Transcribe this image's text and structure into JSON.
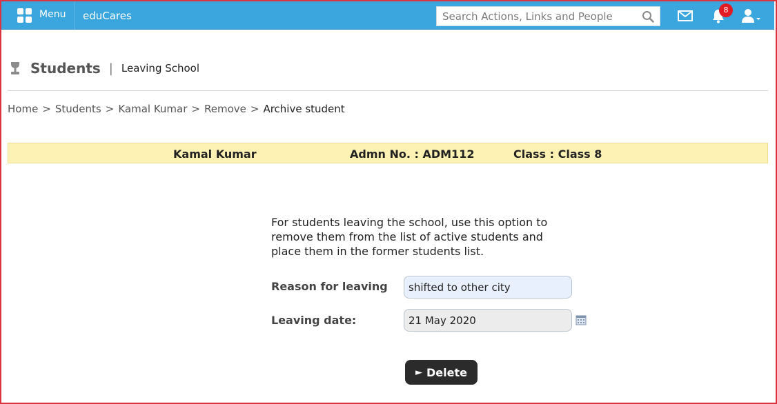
{
  "header": {
    "menu_label": "Menu",
    "brand": "eduCares",
    "search_placeholder": "Search Actions, Links and People",
    "notification_count": "8",
    "accent_color": "#3ba5dd"
  },
  "page": {
    "title": "Students",
    "separator": "|",
    "subtitle": "Leaving School"
  },
  "breadcrumb": {
    "items": [
      "Home",
      "Students",
      "Kamal Kumar",
      "Remove"
    ],
    "current": "Archive student",
    "divider": ">"
  },
  "student": {
    "name": "Kamal Kumar",
    "admn": "Admn No. : ADM112",
    "class": "Class : Class 8"
  },
  "form": {
    "description": "For students leaving the school, use this option to remove them from the list of active students and place them in the former students list.",
    "reason_label": "Reason for leaving",
    "reason_value": "shifted to other city",
    "date_label": "Leaving date:",
    "date_value": "21 May 2020",
    "delete_label": "Delete",
    "delete_glyph": "►"
  },
  "icons": {
    "menu": "grid-icon",
    "search": "search-icon",
    "mail": "mail-icon",
    "notifications": "bell-icon",
    "user": "user-icon",
    "page": "trophy-icon",
    "date_picker": "calendar-icon"
  }
}
